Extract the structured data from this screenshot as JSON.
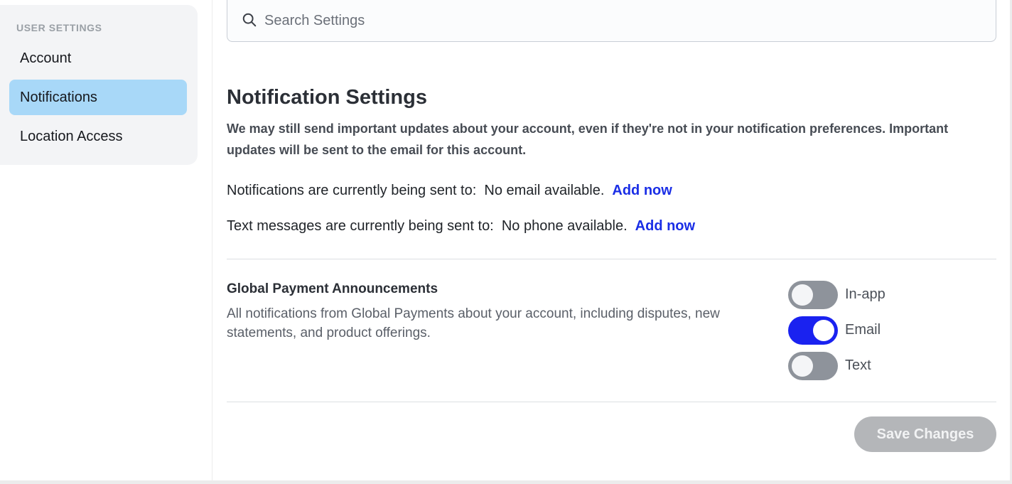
{
  "sidebar": {
    "heading": "USER SETTINGS",
    "items": [
      {
        "label": "Account"
      },
      {
        "label": "Notifications"
      },
      {
        "label": "Location Access"
      }
    ]
  },
  "search": {
    "placeholder": "Search Settings",
    "value": ""
  },
  "main": {
    "title": "Notification Settings",
    "description": "We may still send important updates about your account, even if they're not in your notification preferences. Important updates will be sent to the email for this account.",
    "email_row": {
      "label": "Notifications are currently being sent to:  No email available.",
      "link": "Add now"
    },
    "phone_row": {
      "label": "Text messages are currently being sent to:  No phone available.",
      "link": "Add now"
    },
    "preference": {
      "title": "Global Payment Announcements",
      "description": "All notifications from Global Payments about your account, including disputes, new statements, and product offerings.",
      "toggles": [
        {
          "label": "In-app",
          "on": false
        },
        {
          "label": "Email",
          "on": true
        },
        {
          "label": "Text",
          "on": false
        }
      ]
    },
    "save_label": "Save Changes"
  },
  "colors": {
    "accent": "#1a22f0",
    "link": "#1a2ee6",
    "active_nav": "#a8d8f8",
    "toggle_off": "#8e939b",
    "button_disabled": "#b4b6b9"
  }
}
